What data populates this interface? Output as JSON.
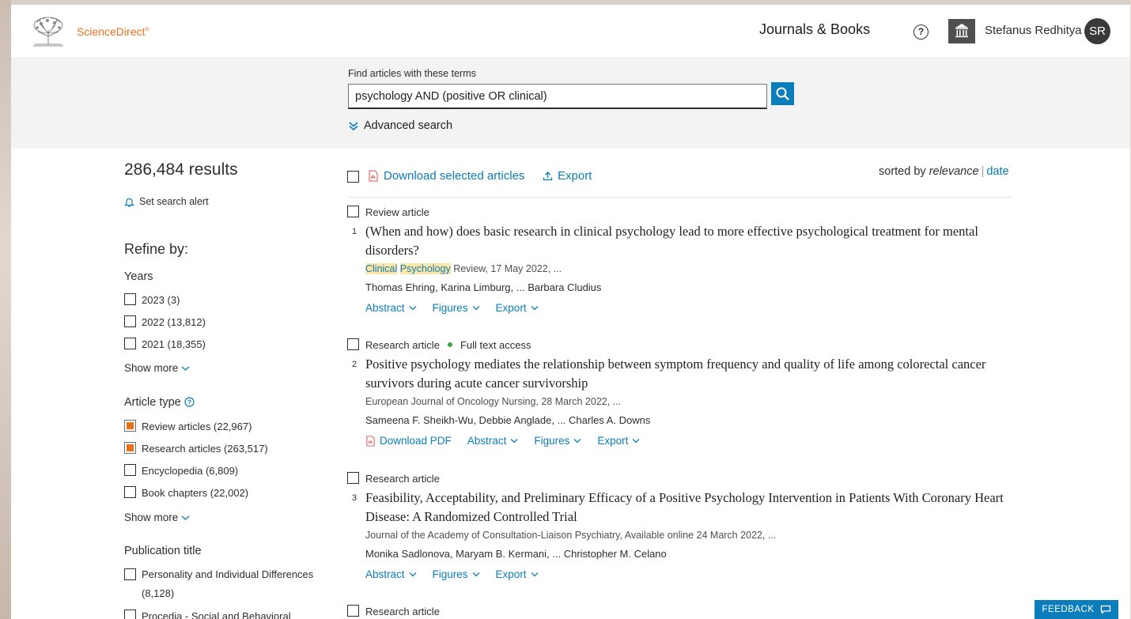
{
  "header": {
    "logo_text": "ScienceDirect",
    "logo_trademark": "®",
    "journals_books": "Journals & Books",
    "help_icon": "question-circle-icon",
    "institution_icon": "institution-icon",
    "user_name": "Stefanus Redhitya",
    "avatar_initials": "SR"
  },
  "search": {
    "label": "Find articles with these terms",
    "value": "psychology AND (positive OR clinical)",
    "button_icon": "search-icon",
    "advanced_label": "Advanced search"
  },
  "sidebar": {
    "results_count": "286,484 results",
    "alert_label": "Set search alert",
    "refine_title": "Refine by:",
    "years_title": "Years",
    "years": [
      {
        "label": "2023 (3)",
        "checked": false
      },
      {
        "label": "2022 (13,812)",
        "checked": false
      },
      {
        "label": "2021 (18,355)",
        "checked": false
      }
    ],
    "show_more_1": "Show more",
    "article_type_title": "Article type",
    "article_types": [
      {
        "label": "Review articles (22,967)",
        "checked": true
      },
      {
        "label": "Research articles (263,517)",
        "checked": true
      },
      {
        "label": "Encyclopedia (6,809)",
        "checked": false
      },
      {
        "label": "Book chapters (22,002)",
        "checked": false
      }
    ],
    "show_more_2": "Show more",
    "publication_title": "Publication title",
    "publications": [
      {
        "label": "Personality and Individual Differences (8,128)",
        "checked": false
      },
      {
        "label": "Procedia - Social and Behavioral",
        "checked": false
      }
    ]
  },
  "toolbar": {
    "download_selected": "Download selected articles",
    "export": "Export",
    "sorted_by": "sorted by",
    "relevance": "relevance",
    "separator": "|",
    "date": "date"
  },
  "results": [
    {
      "index": "1",
      "type": "Review article",
      "access": "",
      "title": "(When and how) does basic research in clinical psychology lead to more effective psychological treatment for mental disorders?",
      "source_hl1": "Clinical",
      "source_hl2": "Psychology",
      "source_rest": " Review, 17 May 2022, ...",
      "authors": "Thomas Ehring, Karina Limburg, ... Barbara Cludius",
      "actions": [
        "Abstract",
        "Figures",
        "Export"
      ]
    },
    {
      "index": "2",
      "type": "Research article",
      "access": "Full text access",
      "title": "Positive psychology mediates the relationship between symptom frequency and quality of life among colorectal cancer survivors during acute cancer survivorship",
      "source": "European Journal of Oncology Nursing, 28 March 2022, ...",
      "authors": "Sameena F. Sheikh-Wu, Debbie Anglade, ... Charles A. Downs",
      "download_pdf": "Download PDF",
      "actions": [
        "Abstract",
        "Figures",
        "Export"
      ]
    },
    {
      "index": "3",
      "type": "Research article",
      "access": "",
      "title": "Feasibility, Acceptability, and Preliminary Efficacy of a Positive Psychology Intervention in Patients With Coronary Heart Disease: A Randomized Controlled Trial",
      "source": "Journal of the Academy of Consultation-Liaison Psychiatry, Available online 24 March 2022, ...",
      "authors": "Monika Sadlonova, Maryam B. Kermani, ... Christopher M. Celano",
      "actions": [
        "Abstract",
        "Figures",
        "Export"
      ]
    },
    {
      "type": "Research article"
    }
  ],
  "feedback": "FEEDBACK"
}
